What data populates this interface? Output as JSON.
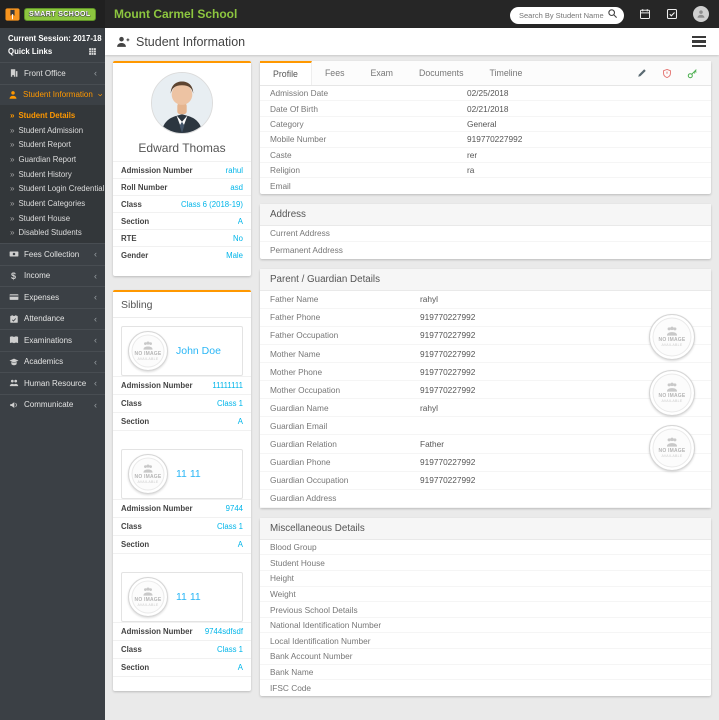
{
  "colors": {
    "accent_orange": "#ff9800",
    "brand_green": "#8dc63f",
    "link_blue": "#00b5e9",
    "navbar_bg": "#262626",
    "sidebar_bg": "#3b4045",
    "danger_red": "#e4726f",
    "success_green": "#4caf50"
  },
  "topbar": {
    "logo_text": "SMART SCHOOL",
    "school_name": "Mount Carmel School",
    "search_placeholder": "Search By Student Name"
  },
  "sidebar": {
    "session": "Current Session: 2017-18",
    "quick_links": "Quick Links",
    "items": [
      {
        "label": "Front Office",
        "icon": "building-icon",
        "state": "collapsed"
      },
      {
        "label": "Student Information",
        "icon": "student-icon",
        "state": "expanded",
        "active": true
      },
      {
        "label": "Fees Collection",
        "icon": "banknote-icon",
        "state": "collapsed"
      },
      {
        "label": "Income",
        "icon": "dollar-icon",
        "state": "collapsed"
      },
      {
        "label": "Expenses",
        "icon": "credit-card-icon",
        "state": "collapsed"
      },
      {
        "label": "Attendance",
        "icon": "calendar-check-icon",
        "state": "collapsed"
      },
      {
        "label": "Examinations",
        "icon": "book-icon",
        "state": "collapsed"
      },
      {
        "label": "Academics",
        "icon": "graduation-cap-icon",
        "state": "collapsed"
      },
      {
        "label": "Human Resource",
        "icon": "users-icon",
        "state": "collapsed"
      },
      {
        "label": "Communicate",
        "icon": "megaphone-icon",
        "state": "collapsed"
      }
    ],
    "student_information_submenu": [
      {
        "label": "Student Details",
        "active": true
      },
      {
        "label": "Student Admission"
      },
      {
        "label": "Student Report"
      },
      {
        "label": "Guardian Report"
      },
      {
        "label": "Student History"
      },
      {
        "label": "Student Login Credential"
      },
      {
        "label": "Student Categories"
      },
      {
        "label": "Student House"
      },
      {
        "label": "Disabled Students"
      }
    ]
  },
  "page": {
    "title": "Student Information"
  },
  "student_card": {
    "name": "Edward Thomas",
    "rows": [
      {
        "label": "Admission Number",
        "value": "rahul"
      },
      {
        "label": "Roll Number",
        "value": "asd"
      },
      {
        "label": "Class",
        "value": "Class 6 (2018-19)"
      },
      {
        "label": "Section",
        "value": "A"
      },
      {
        "label": "RTE",
        "value": "No"
      },
      {
        "label": "Gender",
        "value": "Male"
      }
    ]
  },
  "sibling_card": {
    "title": "Sibling",
    "no_image_text": "NO IMAGE",
    "no_image_subtext": "AVAILABLE",
    "siblings": [
      {
        "name": "John Doe",
        "rows": [
          {
            "label": "Admission Number",
            "value": "11111111"
          },
          {
            "label": "Class",
            "value": "Class 1"
          },
          {
            "label": "Section",
            "value": "A"
          }
        ]
      },
      {
        "name": "11 11",
        "rows": [
          {
            "label": "Admission Number",
            "value": "9744"
          },
          {
            "label": "Class",
            "value": "Class 1"
          },
          {
            "label": "Section",
            "value": "A"
          }
        ]
      },
      {
        "name": "11 11",
        "rows": [
          {
            "label": "Admission Number",
            "value": "9744sdfsdf"
          },
          {
            "label": "Class",
            "value": "Class 1"
          },
          {
            "label": "Section",
            "value": "A"
          }
        ]
      }
    ]
  },
  "tabs": {
    "items": [
      {
        "label": "Profile",
        "active": true
      },
      {
        "label": "Fees"
      },
      {
        "label": "Exam"
      },
      {
        "label": "Documents"
      },
      {
        "label": "Timeline"
      }
    ],
    "actions": [
      "edit-icon",
      "disable-icon",
      "password-icon"
    ]
  },
  "profile_tab": {
    "rows": [
      {
        "label": "Admission Date",
        "value": "02/25/2018"
      },
      {
        "label": "Date Of Birth",
        "value": "02/21/2018"
      },
      {
        "label": "Category",
        "value": "General"
      },
      {
        "label": "Mobile Number",
        "value": "919770227992"
      },
      {
        "label": "Caste",
        "value": "rer"
      },
      {
        "label": "Religion",
        "value": "ra"
      },
      {
        "label": "Email",
        "value": ""
      }
    ],
    "address": {
      "title": "Address",
      "rows": [
        {
          "label": "Current Address",
          "value": ""
        },
        {
          "label": "Permanent Address",
          "value": ""
        }
      ]
    },
    "guardian": {
      "title": "Parent / Guardian Details",
      "rows": [
        {
          "label": "Father Name",
          "value": "rahyl"
        },
        {
          "label": "Father Phone",
          "value": "919770227992"
        },
        {
          "label": "Father Occupation",
          "value": "919770227992"
        },
        {
          "label": "Mother Name",
          "value": "919770227992"
        },
        {
          "label": "Mother Phone",
          "value": "919770227992"
        },
        {
          "label": "Mother Occupation",
          "value": "919770227992"
        },
        {
          "label": "Guardian Name",
          "value": "rahyl"
        },
        {
          "label": "Guardian Email",
          "value": ""
        },
        {
          "label": "Guardian Relation",
          "value": "Father"
        },
        {
          "label": "Guardian Phone",
          "value": "919770227992"
        },
        {
          "label": "Guardian Occupation",
          "value": "919770227992"
        },
        {
          "label": "Guardian Address",
          "value": ""
        }
      ]
    },
    "misc": {
      "title": "Miscellaneous Details",
      "rows": [
        {
          "label": "Blood Group",
          "value": ""
        },
        {
          "label": "Student House",
          "value": ""
        },
        {
          "label": "Height",
          "value": ""
        },
        {
          "label": "Weight",
          "value": ""
        },
        {
          "label": "Previous School Details",
          "value": ""
        },
        {
          "label": "National Identification Number",
          "value": ""
        },
        {
          "label": "Local Identification Number",
          "value": ""
        },
        {
          "label": "Bank Account Number",
          "value": ""
        },
        {
          "label": "Bank Name",
          "value": ""
        },
        {
          "label": "IFSC Code",
          "value": ""
        }
      ]
    }
  }
}
